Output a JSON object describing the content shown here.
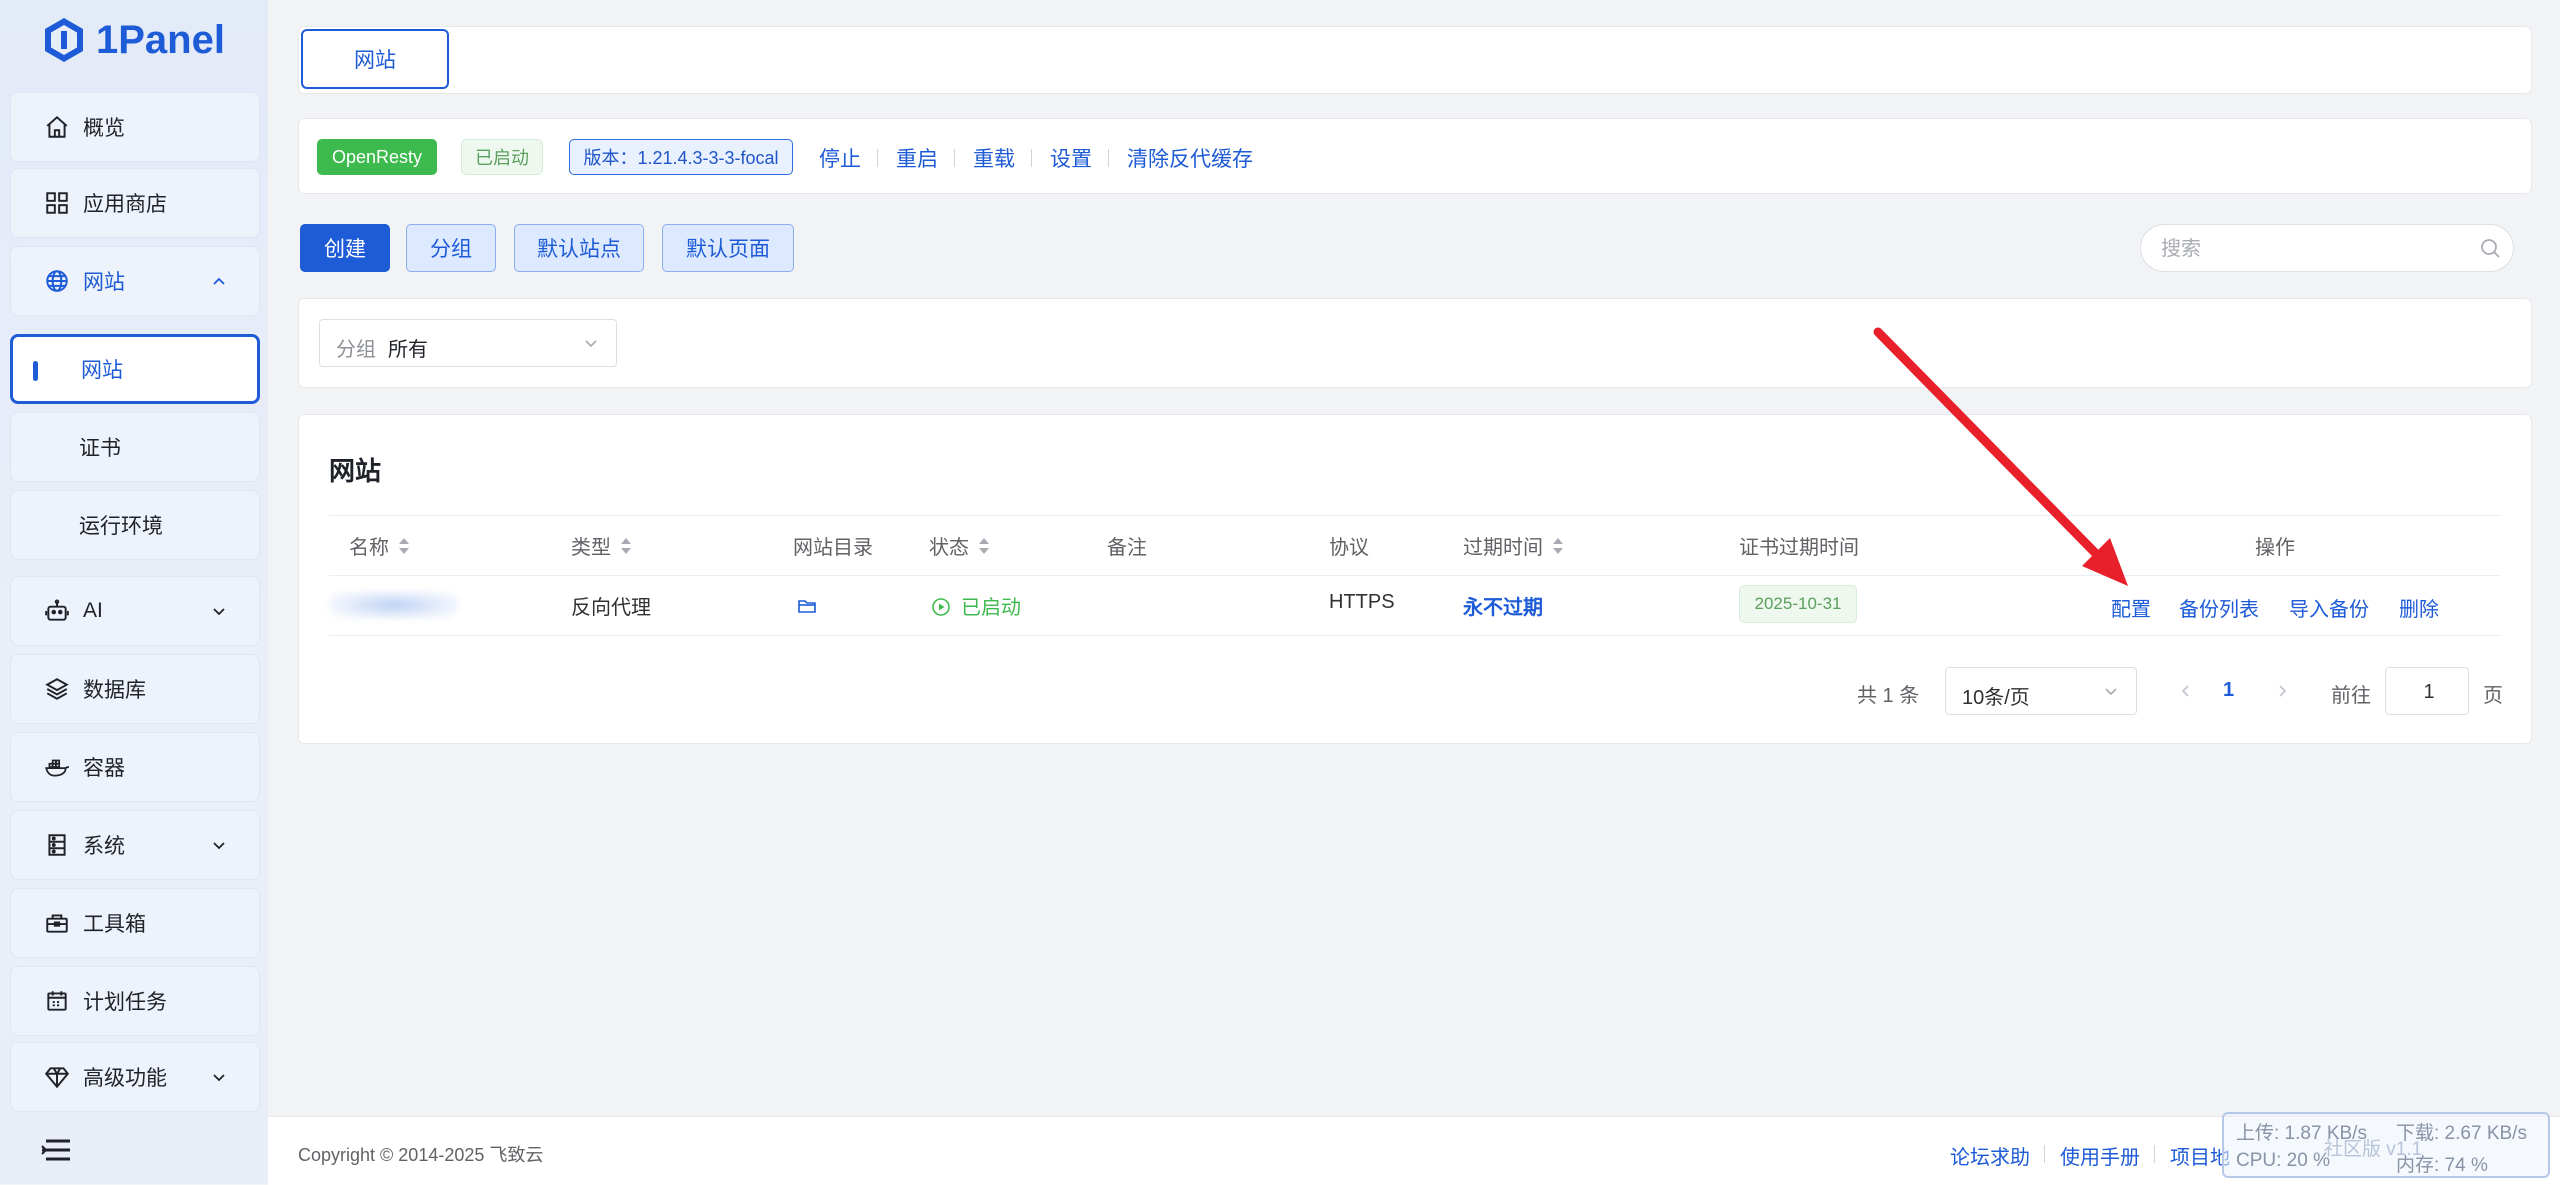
{
  "brand": {
    "name": "1Panel"
  },
  "sidebar": {
    "items": [
      {
        "label": "概览"
      },
      {
        "label": "应用商店"
      },
      {
        "label": "网站"
      },
      {
        "label": "网站"
      },
      {
        "label": "证书"
      },
      {
        "label": "运行环境"
      },
      {
        "label": "AI"
      },
      {
        "label": "数据库"
      },
      {
        "label": "容器"
      },
      {
        "label": "系统"
      },
      {
        "label": "工具箱"
      },
      {
        "label": "计划任务"
      },
      {
        "label": "高级功能"
      }
    ]
  },
  "tabs": {
    "active": "网站"
  },
  "server": {
    "name": "OpenResty",
    "status": "已启动",
    "version": "版本：1.21.4.3-3-3-focal",
    "actions": [
      "停止",
      "重启",
      "重载",
      "设置",
      "清除反代缓存"
    ]
  },
  "toolbar": {
    "buttons": [
      "创建",
      "分组",
      "默认站点",
      "默认页面"
    ],
    "search_placeholder": "搜索"
  },
  "filter": {
    "prefix": "分组",
    "value": "所有"
  },
  "table": {
    "title": "网站",
    "columns": [
      "名称",
      "类型",
      "网站目录",
      "状态",
      "备注",
      "协议",
      "过期时间",
      "证书过期时间",
      "操作"
    ],
    "rows": [
      {
        "type": "反向代理",
        "status": "已启动",
        "protocol": "HTTPS",
        "expire": "永不过期",
        "cert_expire": "2025-10-31",
        "ops": [
          "配置",
          "备份列表",
          "导入备份",
          "删除"
        ]
      }
    ],
    "pager": {
      "total": "共 1 条",
      "page_size": "10条/页",
      "current": "1",
      "goto_label": "前往",
      "goto_value": "1",
      "page_unit": "页"
    }
  },
  "footer": {
    "copyright": "Copyright © 2014-2025 飞致云",
    "links": [
      "论坛求助",
      "使用手册",
      "项目地"
    ]
  },
  "monitor": {
    "upload": "上传: 1.87 KB/s",
    "download": "下载: 2.67 KB/s",
    "cpu": "CPU: 20 %",
    "mem": "内存: 74 %",
    "version": "社区版 v1.1"
  },
  "colors": {
    "accent": "#1d5bd7",
    "success": "#3dba4e",
    "annotation": "#e8202a"
  }
}
